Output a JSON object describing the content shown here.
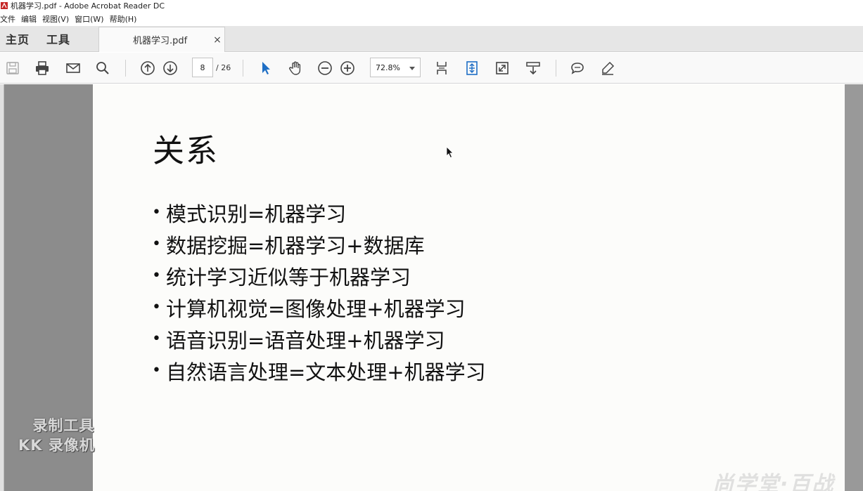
{
  "window": {
    "title": "机器学习.pdf - Adobe Acrobat Reader DC"
  },
  "menu": {
    "items": [
      "文件",
      "编辑",
      "视图(V)",
      "窗口(W)",
      "帮助(H)"
    ]
  },
  "tabs": {
    "home": "主页",
    "tools": "工具",
    "document": "机器学习.pdf",
    "close": "×"
  },
  "toolbar": {
    "icons": [
      "save-icon",
      "print-icon",
      "email-icon",
      "search-icon",
      "page-up-icon",
      "page-down-icon",
      "select-cursor-icon",
      "hand-icon",
      "zoom-out-icon",
      "zoom-in-icon",
      "fit-page-icon",
      "fit-width-icon",
      "fullscreen-icon",
      "read-mode-icon",
      "comment-icon",
      "highlight-icon"
    ],
    "current_page": "8",
    "page_total": "/ 26",
    "zoom": "72.8%"
  },
  "slide": {
    "title": "关系",
    "bullets": [
      "模式识别=机器学习",
      "数据挖掘=机器学习+数据库",
      "统计学习近似等于机器学习",
      "计算机视觉=图像处理+机器学习",
      "语音识别=语音处理+机器学习",
      "自然语言处理=文本处理+机器学习"
    ]
  },
  "watermarks": {
    "recorder_line1": "录制工具",
    "recorder_line2": "KK 录像机",
    "brand": "尚学堂·百战"
  },
  "colors": {
    "accent_blue": "#1f6fc5",
    "toolbar_bg": "#f9f9f9",
    "doc_bg": "#8c8c8c"
  }
}
